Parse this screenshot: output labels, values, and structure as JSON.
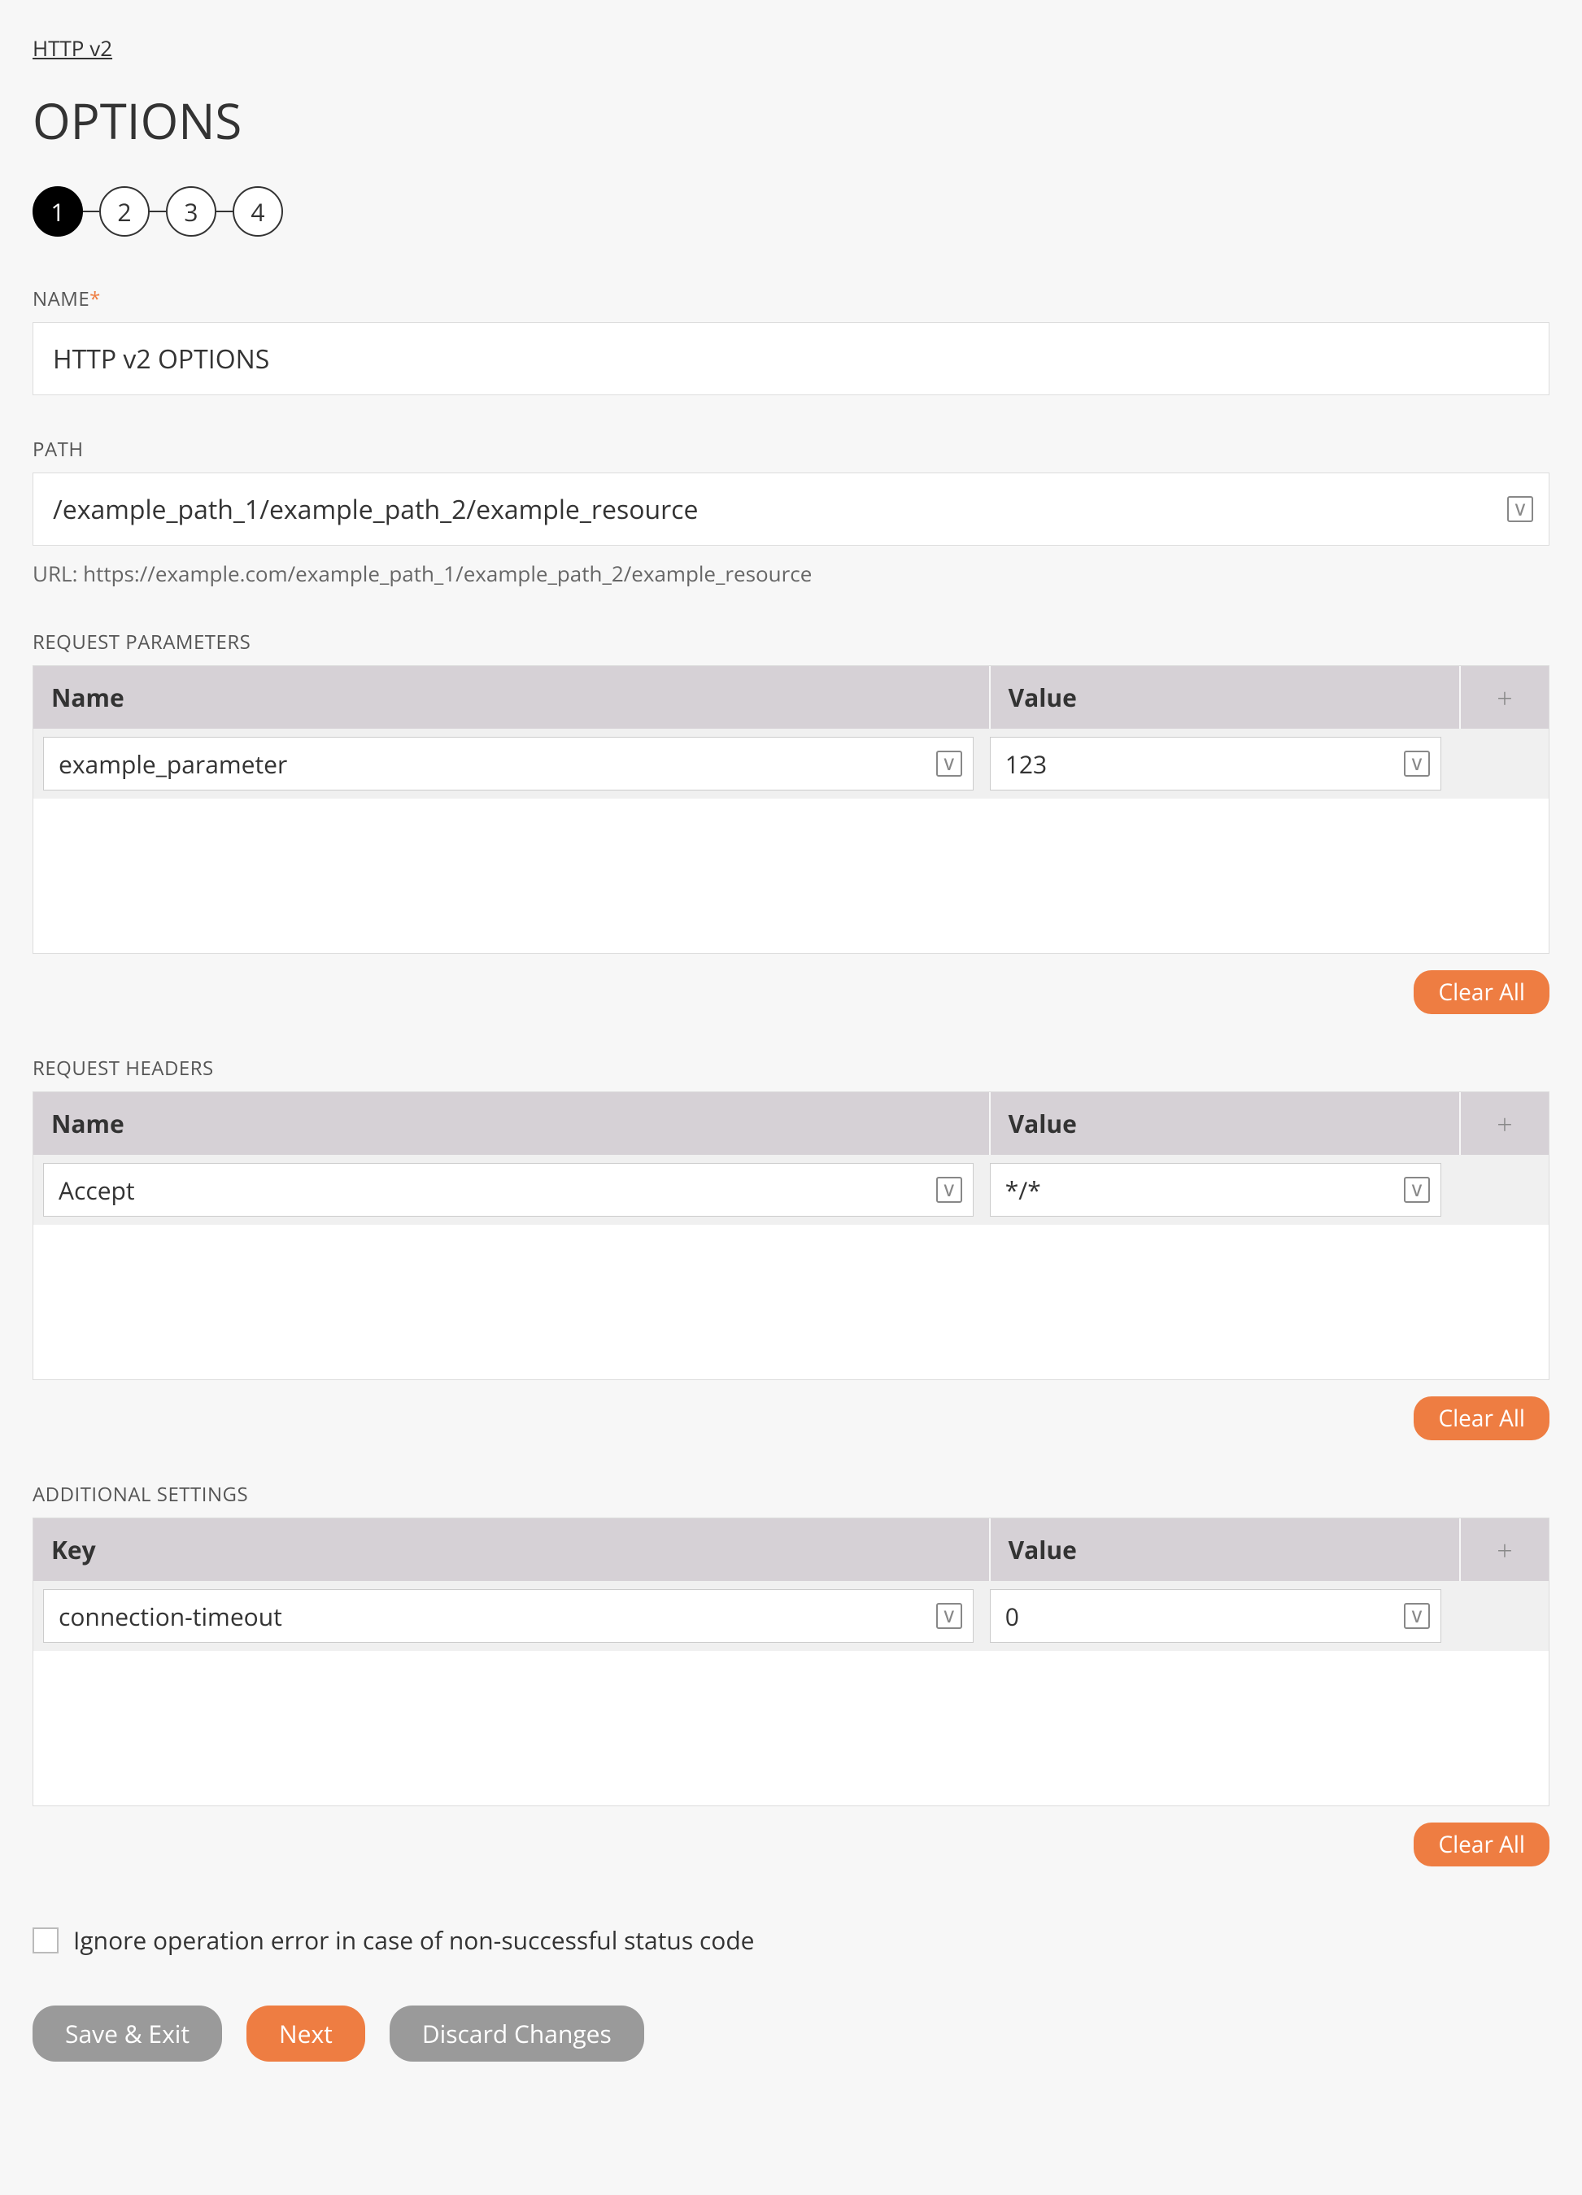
{
  "breadcrumb": "HTTP v2",
  "page_title": "OPTIONS",
  "steps": {
    "active": 1,
    "total": 4
  },
  "name_field": {
    "label": "NAME",
    "required": true,
    "value": "HTTP v2 OPTIONS"
  },
  "path_field": {
    "label": "PATH",
    "value": "/example_path_1/example_path_2/example_resource",
    "url_hint": "URL: https://example.com/example_path_1/example_path_2/example_resource"
  },
  "request_parameters": {
    "label": "REQUEST PARAMETERS",
    "columns": {
      "name": "Name",
      "value": "Value"
    },
    "rows": [
      {
        "name": "example_parameter",
        "value": "123"
      }
    ],
    "clear_label": "Clear All"
  },
  "request_headers": {
    "label": "REQUEST HEADERS",
    "columns": {
      "name": "Name",
      "value": "Value"
    },
    "rows": [
      {
        "name": "Accept",
        "value": "*/*"
      }
    ],
    "clear_label": "Clear All"
  },
  "additional_settings": {
    "label": "ADDITIONAL SETTINGS",
    "columns": {
      "name": "Key",
      "value": "Value"
    },
    "rows": [
      {
        "name": "connection-timeout",
        "value": "0"
      }
    ],
    "clear_label": "Clear All"
  },
  "ignore_error": {
    "checked": false,
    "label": "Ignore operation error in case of non-successful status code"
  },
  "actions": {
    "save_exit": "Save & Exit",
    "next": "Next",
    "discard": "Discard Changes"
  },
  "icons": {
    "variable": "V",
    "add": "+"
  }
}
